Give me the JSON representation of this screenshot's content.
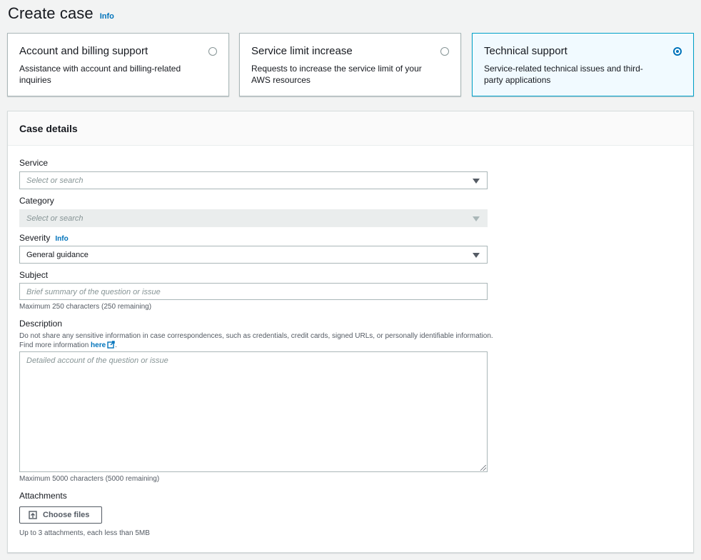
{
  "header": {
    "title": "Create case",
    "info": "Info"
  },
  "case_types": [
    {
      "title": "Account and billing support",
      "description": "Assistance with account and billing-related inquiries",
      "selected": false
    },
    {
      "title": "Service limit increase",
      "description": "Requests to increase the service limit of your AWS resources",
      "selected": false
    },
    {
      "title": "Technical support",
      "description": "Service-related technical issues and third-party applications",
      "selected": true
    }
  ],
  "panel": {
    "title": "Case details",
    "service": {
      "label": "Service",
      "placeholder": "Select or search"
    },
    "category": {
      "label": "Category",
      "placeholder": "Select or search",
      "disabled": true
    },
    "severity": {
      "label": "Severity",
      "info": "Info",
      "value": "General guidance"
    },
    "subject": {
      "label": "Subject",
      "placeholder": "Brief summary of the question or issue",
      "hint": "Maximum 250 characters (250 remaining)"
    },
    "description": {
      "label": "Description",
      "note_line1": "Do not share any sensitive information in case correspondences, such as credentials, credit cards, signed URLs, or personally identifiable information.",
      "note_prefix": "Find more information",
      "note_link": "here",
      "note_suffix": ".",
      "placeholder": "Detailed account of the question or issue",
      "hint": "Maximum 5000 characters (5000 remaining)"
    },
    "attachments": {
      "label": "Attachments",
      "button": "Choose files",
      "hint": "Up to 3 attachments, each less than 5MB"
    }
  },
  "colors": {
    "accent": "#0073bb",
    "selected_border": "#00a1c9",
    "selected_bg": "#f1faff"
  }
}
